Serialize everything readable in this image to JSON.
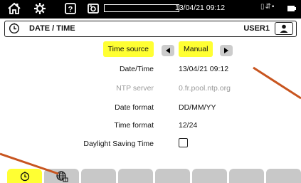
{
  "status_bar": {
    "datetime": "13/04/21 09:12",
    "icons": [
      "home-icon",
      "settings-icon",
      "help-icon",
      "camera-icon",
      "progress-bar",
      "battery-icon"
    ]
  },
  "header": {
    "title": "DATE / TIME",
    "user": "USER1",
    "icons": [
      "clock-icon",
      "user-icon"
    ]
  },
  "form": {
    "time_source": {
      "label": "Time source",
      "value": "Manual"
    },
    "date_time": {
      "label": "Date/Time",
      "value": "13/04/21 09:12"
    },
    "ntp_server": {
      "label": "NTP server",
      "value": "0.fr.pool.ntp.org"
    },
    "date_format": {
      "label": "Date format",
      "value": "DD/MM/YY"
    },
    "time_format": {
      "label": "Time format",
      "value": "12/24"
    },
    "dst": {
      "label": "Daylight Saving Time",
      "checked": false
    }
  },
  "tabs": [
    {
      "icon": "clock-icon",
      "active": true
    },
    {
      "icon": "globe-icon",
      "active": false
    },
    {
      "icon": "",
      "active": false
    },
    {
      "icon": "",
      "active": false
    },
    {
      "icon": "",
      "active": false
    },
    {
      "icon": "",
      "active": false
    },
    {
      "icon": "",
      "active": false
    },
    {
      "icon": "",
      "active": false
    }
  ],
  "colors": {
    "highlight": "#ffff33",
    "annotation_line": "#c8551f",
    "tab_inactive": "#c8c8c8",
    "disabled_text": "#9a9a9a"
  }
}
